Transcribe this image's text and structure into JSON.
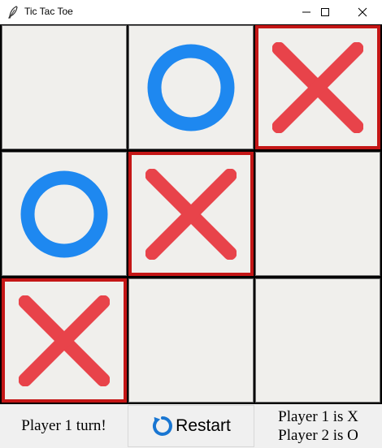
{
  "window": {
    "title": "Tic Tac Toe",
    "icon": "feather-icon",
    "controls": [
      "minimize-icon",
      "maximize-icon",
      "close-icon"
    ]
  },
  "board": {
    "cells": [
      {
        "row": 1,
        "col": 1,
        "mark": "",
        "winning": false
      },
      {
        "row": 1,
        "col": 2,
        "mark": "O",
        "winning": false
      },
      {
        "row": 1,
        "col": 3,
        "mark": "X",
        "winning": true
      },
      {
        "row": 2,
        "col": 1,
        "mark": "O",
        "winning": false
      },
      {
        "row": 2,
        "col": 2,
        "mark": "X",
        "winning": true
      },
      {
        "row": 2,
        "col": 3,
        "mark": "",
        "winning": false
      },
      {
        "row": 3,
        "col": 1,
        "mark": "X",
        "winning": true
      },
      {
        "row": 3,
        "col": 2,
        "mark": "",
        "winning": false
      },
      {
        "row": 3,
        "col": 3,
        "mark": "",
        "winning": false
      }
    ]
  },
  "colors": {
    "x_mark": "#e8434a",
    "o_mark": "#1e88f0",
    "win_border": "#c41616",
    "cell_bg": "#f0efec",
    "restart_icon": "#1976d2"
  },
  "status": {
    "turn_label": "Player 1 turn!",
    "restart_label": "Restart",
    "restart_icon": "restart-icon",
    "player1_label": "Player 1 is X",
    "player2_label": "Player 2 is O"
  }
}
